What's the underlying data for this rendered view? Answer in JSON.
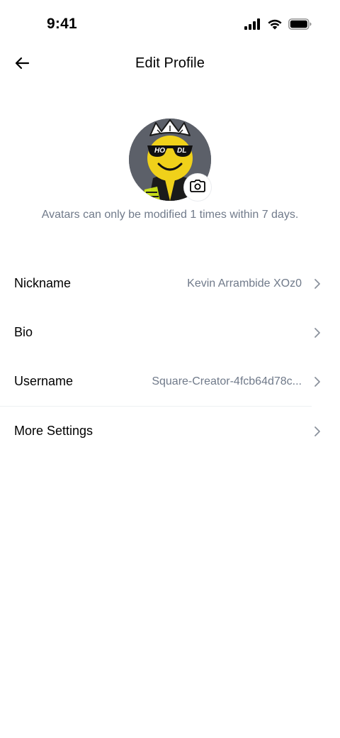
{
  "status_bar": {
    "time": "9:41",
    "icons": [
      "cellular-signal-icon",
      "wifi-icon",
      "battery-icon"
    ]
  },
  "header": {
    "title": "Edit Profile",
    "back_icon": "arrow-left-icon"
  },
  "avatar": {
    "note": "Avatars can only be modified 1 times within 7 days.",
    "artwork_text": "HODL",
    "camera_icon": "camera-icon"
  },
  "settings": [
    {
      "label": "Nickname",
      "value": "Kevin Arrambide XOz0"
    },
    {
      "label": "Bio",
      "value": ""
    },
    {
      "label": "Username",
      "value": "Square-Creator-4fcb64d78c..."
    },
    {
      "label": "More Settings",
      "value": ""
    }
  ],
  "colors": {
    "text_primary": "#000000",
    "text_secondary": "#707a8a",
    "avatar_background": "#5c6069",
    "accent_yellow": "#f0d11a"
  }
}
